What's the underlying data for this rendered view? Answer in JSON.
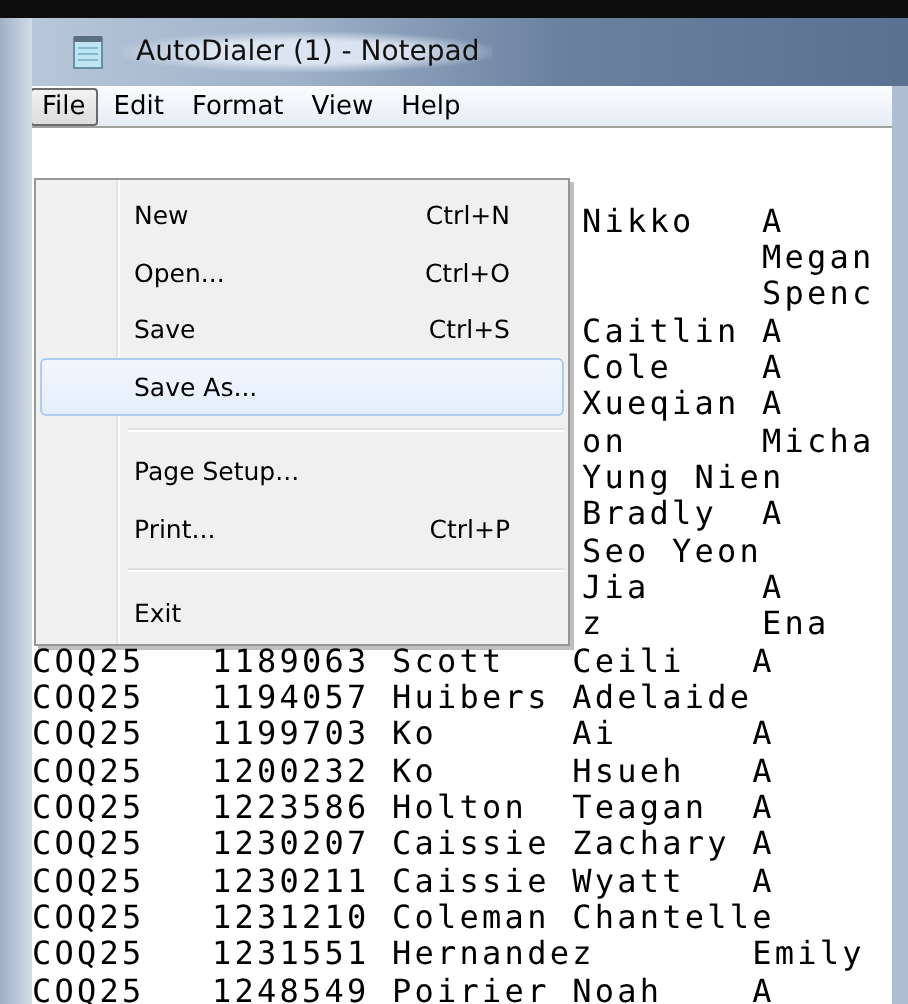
{
  "window": {
    "title": "AutoDialer (1) - Notepad"
  },
  "menubar": [
    {
      "label": "File",
      "selected": true
    },
    {
      "label": "Edit",
      "selected": false
    },
    {
      "label": "Format",
      "selected": false
    },
    {
      "label": "View",
      "selected": false
    },
    {
      "label": "Help",
      "selected": false
    }
  ],
  "menu": {
    "items": [
      {
        "kind": "item",
        "label": "New",
        "shortcut": "Ctrl+N",
        "selected": false
      },
      {
        "kind": "item",
        "label": "Open...",
        "shortcut": "Ctrl+O",
        "selected": false
      },
      {
        "kind": "item",
        "label": "Save",
        "shortcut": "Ctrl+S",
        "selected": false
      },
      {
        "kind": "item",
        "label": "Save As...",
        "selected": true
      },
      {
        "kind": "separator"
      },
      {
        "kind": "item",
        "label": "Page Setup...",
        "selected": false
      },
      {
        "kind": "item",
        "label": "Print...",
        "shortcut": "Ctrl+P",
        "selected": false
      },
      {
        "kind": "separator"
      },
      {
        "kind": "item",
        "label": "Exit",
        "selected": false
      }
    ]
  },
  "editor": {
    "lines": [
      {
        "kind": "tail",
        "text": "Nikko\tA"
      },
      {
        "kind": "tail",
        "text": "\tMegan"
      },
      {
        "kind": "tail",
        "text": "\tSpenc"
      },
      {
        "kind": "tail",
        "text": "Caitlin A"
      },
      {
        "kind": "tail",
        "text": "Cole\tA"
      },
      {
        "kind": "tail",
        "text": "Xueqian A"
      },
      {
        "kind": "tail",
        "text": "on\tMicha"
      },
      {
        "kind": "tail",
        "text": "Yung Nien"
      },
      {
        "kind": "tail",
        "text": "Bradly\tA"
      },
      {
        "kind": "tail",
        "text": "Seo Yeon"
      },
      {
        "kind": "tail",
        "text": "Jia\tA"
      },
      {
        "kind": "tail",
        "text": "z\tEna"
      },
      {
        "kind": "full",
        "text": "COQ25\t1189063\tScott\tCeili\tA"
      },
      {
        "kind": "full",
        "text": "COQ25\t1194057\tHuibers\tAdelaide"
      },
      {
        "kind": "full",
        "text": "COQ25\t1199703\tKo\tAi\tA"
      },
      {
        "kind": "full",
        "text": "COQ25\t1200232\tKo\tHsueh\tA"
      },
      {
        "kind": "full",
        "text": "COQ25\t1223586\tHolton\tTeagan\tA"
      },
      {
        "kind": "full",
        "text": "COQ25\t1230207\tCaissie\tZachary A"
      },
      {
        "kind": "full",
        "text": "COQ25\t1230211\tCaissie\tWyatt\tA"
      },
      {
        "kind": "full",
        "text": "COQ25\t1231210\tColeman\tChantelle"
      },
      {
        "kind": "full",
        "text": "COQ25\t1231551\tHernandez\tEmily"
      },
      {
        "kind": "full",
        "text": "COQ25\t1248549\tPoirier\tNoah\tA"
      }
    ]
  }
}
